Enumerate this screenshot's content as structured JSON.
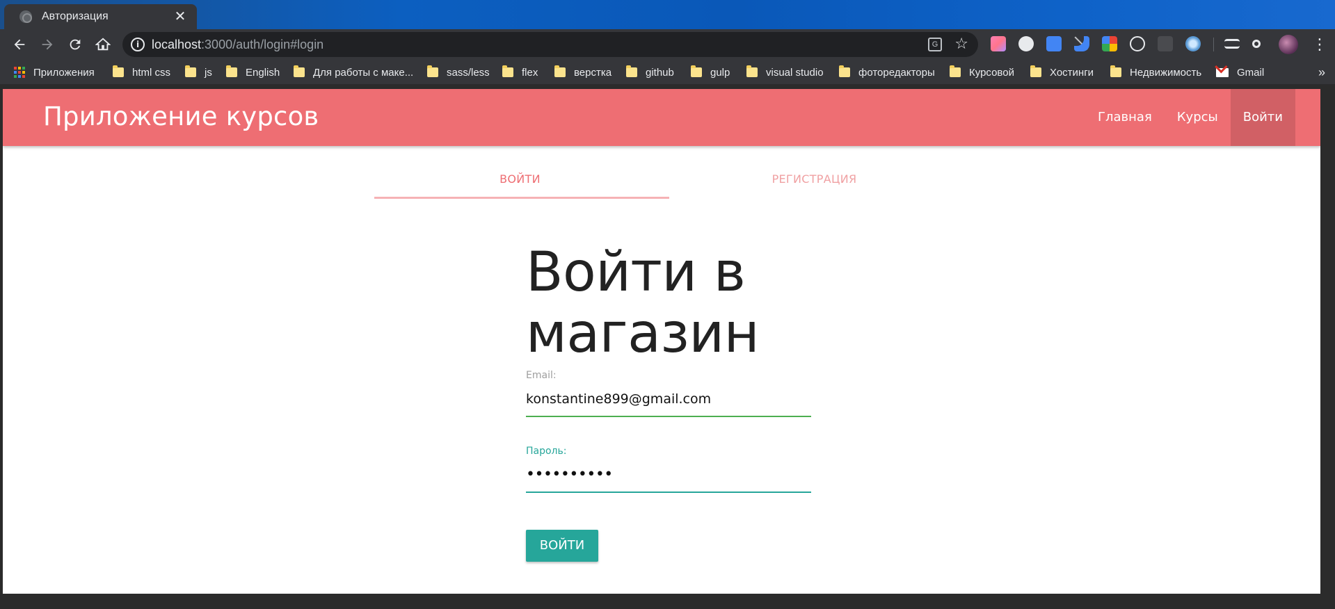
{
  "browser": {
    "tab_title": "Авторизация",
    "tab_close": "✕",
    "url_host": "localhost",
    "url_rest": ":3000/auth/login#login",
    "info_icon": "i",
    "translate_icon": "G",
    "star_icon": "☆",
    "bookmarks": [
      {
        "label": "Приложения",
        "icon": "apps-icon"
      },
      {
        "label": "html css",
        "icon": "folder-icon"
      },
      {
        "label": "js",
        "icon": "folder-icon"
      },
      {
        "label": "English",
        "icon": "folder-icon"
      },
      {
        "label": "Для работы с маке...",
        "icon": "folder-icon"
      },
      {
        "label": "sass/less",
        "icon": "folder-icon"
      },
      {
        "label": "flex",
        "icon": "folder-icon"
      },
      {
        "label": "верстка",
        "icon": "folder-icon"
      },
      {
        "label": "github",
        "icon": "folder-icon"
      },
      {
        "label": "gulp",
        "icon": "folder-icon"
      },
      {
        "label": "visual studio",
        "icon": "folder-icon"
      },
      {
        "label": "фоторедакторы",
        "icon": "folder-icon"
      },
      {
        "label": "Курсовой",
        "icon": "folder-icon"
      },
      {
        "label": "Хостинги",
        "icon": "folder-icon"
      },
      {
        "label": "Недвижимость",
        "icon": "folder-icon"
      },
      {
        "label": "Gmail",
        "icon": "gmail-icon"
      }
    ],
    "bookmarks_more": "»"
  },
  "app": {
    "brand": "Приложение курсов",
    "nav": [
      {
        "label": "Главная",
        "active": false
      },
      {
        "label": "Курсы",
        "active": false
      },
      {
        "label": "Войти",
        "active": true
      }
    ],
    "tabs": [
      {
        "label": "Войти",
        "active": true
      },
      {
        "label": "Регистрация",
        "active": false
      }
    ],
    "login": {
      "heading_line1": "Войти в",
      "heading_line2": "магазин",
      "email_label": "Email:",
      "email_value": "konstantine899@gmail.com",
      "password_label": "Пароль:",
      "password_value": "••••••••••",
      "submit_label": "Войти"
    }
  },
  "colors": {
    "navbar": "#ee6e73",
    "accent_teal": "#26a69a",
    "valid_green": "#4caf50",
    "tab_indicator": "#f6b2b5"
  }
}
